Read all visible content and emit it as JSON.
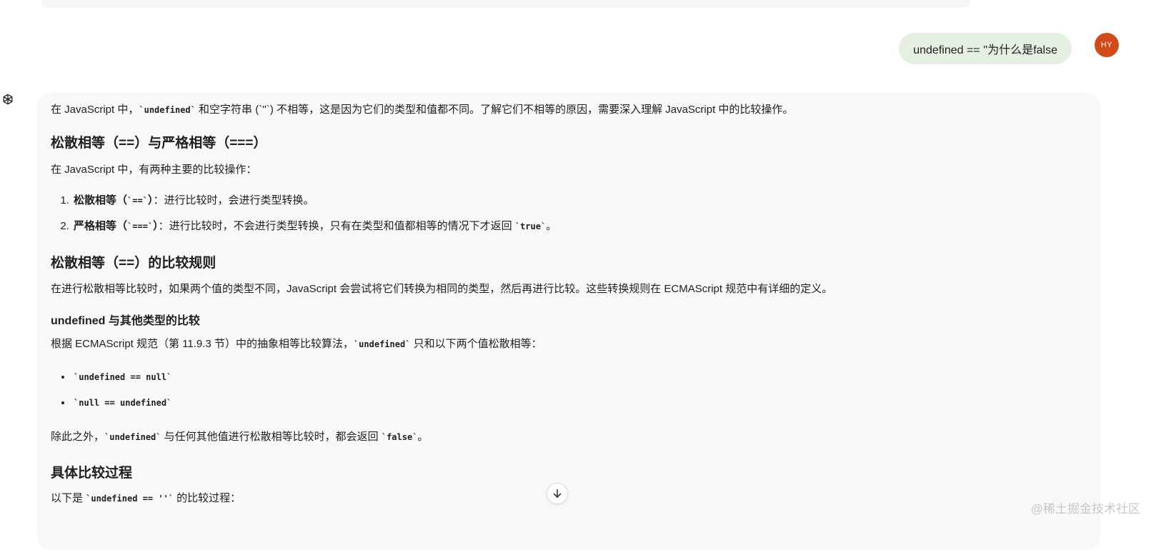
{
  "user_message": {
    "text": "undefined == ''为什么是false",
    "avatar_initials": "HY"
  },
  "assistant_icon": "openai-logo-icon",
  "answer": {
    "intro": {
      "t1": "在 JavaScript 中，",
      "c1": "`undefined`",
      "t2": " 和空字符串 (`''`) 不相等，这是因为它们的类型和值都不同。了解它们不相等的原因，需要深入理解 JavaScript 中的比较操作。"
    },
    "heading_loose_vs_strict": "松散相等（==）与严格相等（===）",
    "comparison_intro": "在 JavaScript 中，有两种主要的比较操作：",
    "comparison_list": [
      {
        "label_start": "松散相等（",
        "label_code": "`==`",
        "label_end": "）",
        "desc": "：进行比较时，会进行类型转换。",
        "desc_code": "",
        "desc_end": ""
      },
      {
        "label_start": "严格相等（",
        "label_code": "`===`",
        "label_end": "）",
        "desc": "：进行比较时，不会进行类型转换，只有在类型和值都相等的情况下才返回 ",
        "desc_code": "`true`",
        "desc_end": "。"
      }
    ],
    "heading_rules": "松散相等（==）的比较规则",
    "rules_text": "在进行松散相等比较时，如果两个值的类型不同，JavaScript 会尝试将它们转换为相同的类型，然后再进行比较。这些转换规则在 ECMAScript 规范中有详细的定义。",
    "heading_undefined": "undefined 与其他类型的比较",
    "spec": {
      "t1": "根据 ECMAScript 规范（第 11.9.3 节）中的抽象相等比较算法，",
      "c1": "`undefined`",
      "t2": " 只和以下两个值松散相等："
    },
    "equal_list": [
      "`undefined == null`",
      "`null == undefined`"
    ],
    "other": {
      "t1": "除此之外，",
      "c1": "`undefined`",
      "t2": " 与任何其他值进行松散相等比较时，都会返回 ",
      "c2": "`false`",
      "t3": "。"
    },
    "heading_process": "具体比较过程",
    "process": {
      "t1": "以下是 ",
      "c1": "`undefined == ''`",
      "t2": " 的比较过程："
    }
  },
  "scroll_button_icon": "arrow-down-icon",
  "watermark": "@稀土掘金技术社区"
}
